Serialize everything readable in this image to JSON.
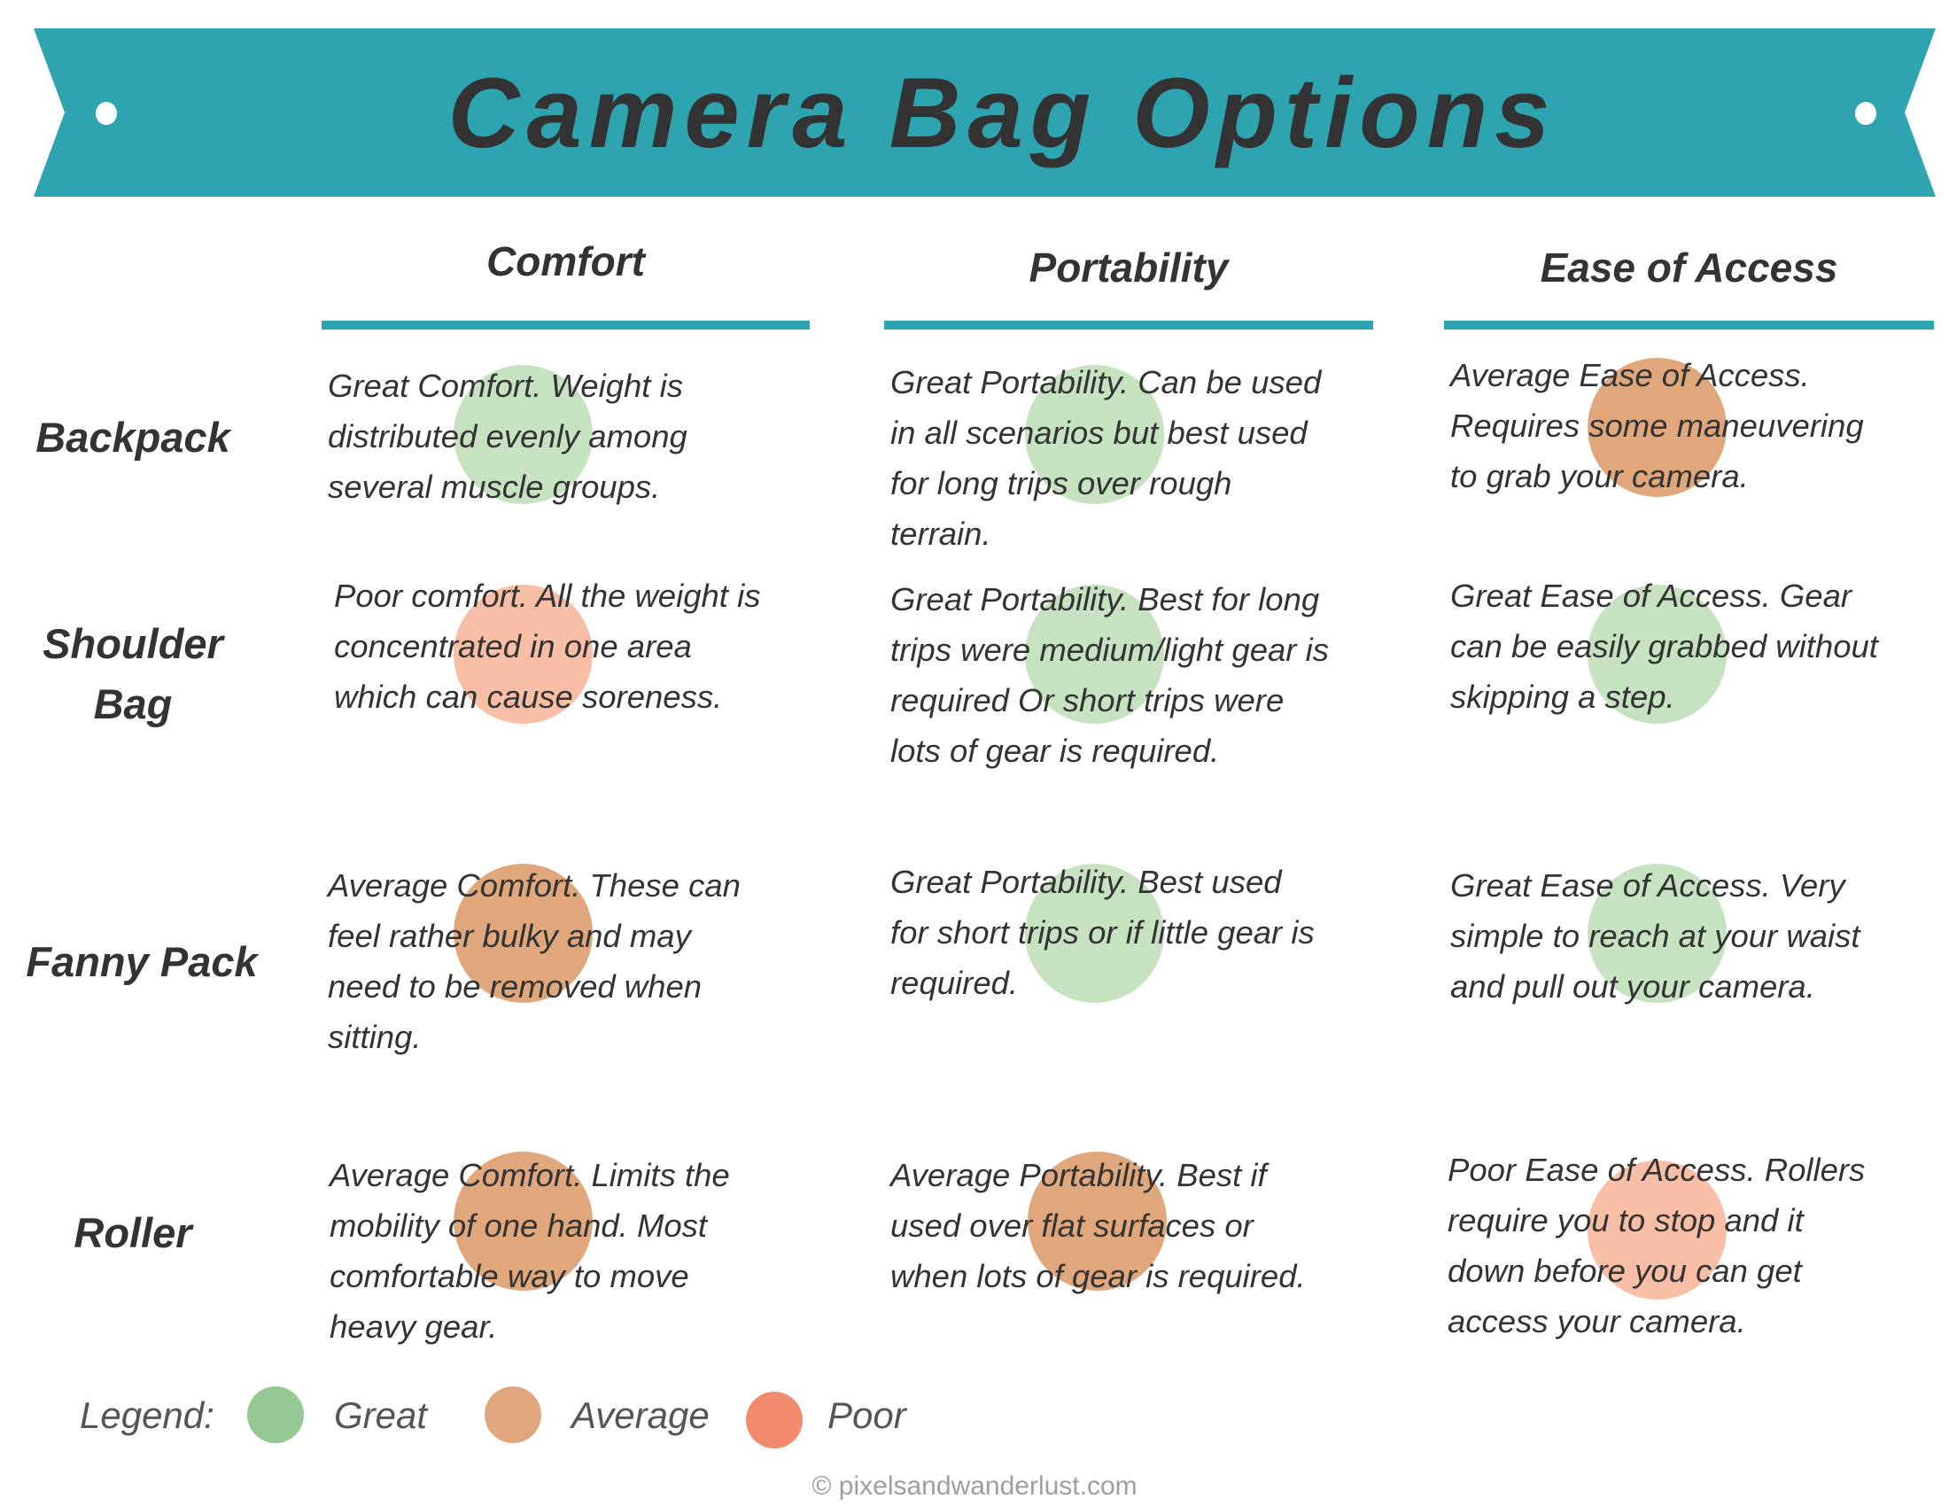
{
  "title": "Camera Bag Options",
  "colors": {
    "banner": "#2ea4b1",
    "text": "#333333",
    "rating_cell": {
      "great": "#c6e2c1",
      "average": "#dfa77b",
      "poor": "#f8bfa6"
    },
    "rating_legend": {
      "great": "#94c993",
      "average": "#e0a67e",
      "poor": "#f28b6e"
    }
  },
  "columns": [
    {
      "label": "Comfort"
    },
    {
      "label": "Portability"
    },
    {
      "label": "Ease of Access"
    }
  ],
  "rows": [
    {
      "label": "Backpack",
      "cells": [
        {
          "rating": "great",
          "text": "Great Comfort.  Weight is\ndistributed evenly among\nseveral muscle groups."
        },
        {
          "rating": "great",
          "text": "Great Portability. Can be used\nin all scenarios but best used\nfor long trips over rough\nterrain."
        },
        {
          "rating": "average",
          "text": "Average Ease of Access.\nRequires some maneuvering\nto grab your camera."
        }
      ]
    },
    {
      "label": "Shoulder\nBag",
      "cells": [
        {
          "rating": "poor",
          "text": "Poor comfort. All the weight is\nconcentrated in one area\nwhich can cause soreness."
        },
        {
          "rating": "great",
          "text": "Great Portability. Best for long\ntrips were medium/light gear is\nrequired Or short trips were\nlots of gear is required."
        },
        {
          "rating": "great",
          "text": "Great Ease of Access. Gear\ncan be easily grabbed without\nskipping a step."
        }
      ]
    },
    {
      "label": "Fanny Pack",
      "cells": [
        {
          "rating": "average",
          "text": "Average Comfort. These can\nfeel rather bulky and may\nneed to be removed when\nsitting."
        },
        {
          "rating": "great",
          "text": "Great Portability. Best used\nfor short trips or if little gear is\nrequired."
        },
        {
          "rating": "great",
          "text": "Great Ease of Access. Very\nsimple to reach at your waist\nand pull out your camera."
        }
      ]
    },
    {
      "label": "Roller",
      "cells": [
        {
          "rating": "average",
          "text": "Average Comfort. Limits the\nmobility of one hand. Most\ncomfortable way to move\nheavy gear."
        },
        {
          "rating": "average",
          "text": "Average Portability. Best if\nused over flat surfaces or\nwhen lots of gear is required."
        },
        {
          "rating": "poor",
          "text": "Poor Ease of Access. Rollers\nrequire you to stop and it\ndown before you can get\naccess your camera."
        }
      ]
    }
  ],
  "legend": {
    "label": "Legend:",
    "items": [
      {
        "rating": "great",
        "label": "Great"
      },
      {
        "rating": "average",
        "label": "Average"
      },
      {
        "rating": "poor",
        "label": "Poor"
      }
    ]
  },
  "footer": "© pixelsandwanderlust.com"
}
